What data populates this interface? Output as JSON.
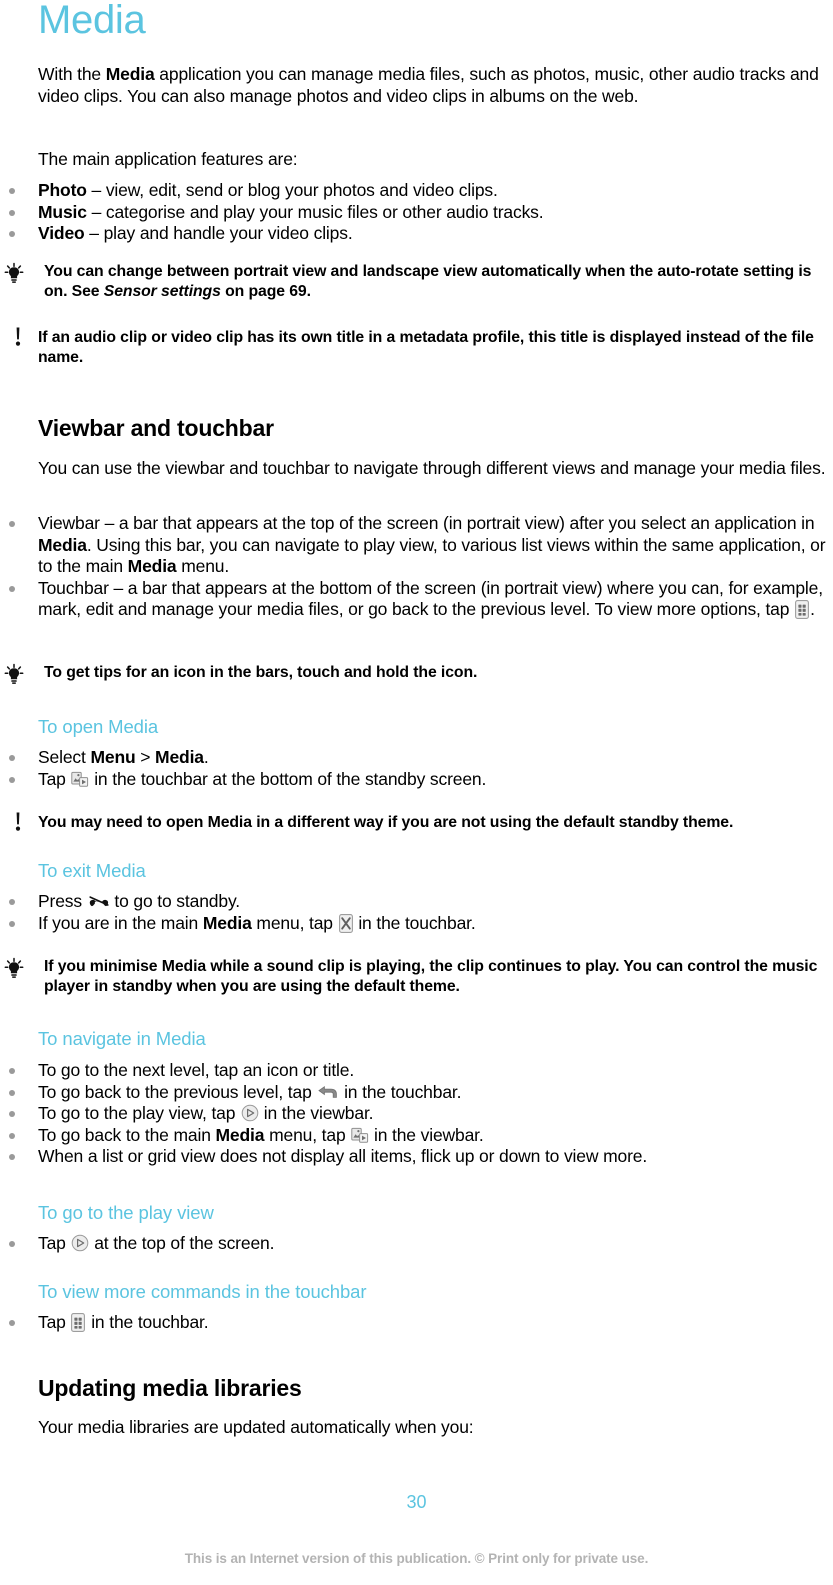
{
  "document": {
    "chapter_title": "Media",
    "page_number": "30",
    "footer": "This is an Internet version of this publication. © Print only for private use.",
    "accent_color": "#5bc4e0",
    "bullet_color": "#9a9a9a"
  },
  "intro": {
    "paragraph_1_pre": "With the ",
    "paragraph_1_bold": "Media",
    "paragraph_1_post": " application you can manage media files, such as photos, music, other audio tracks and video clips. You can also manage photos and video clips in albums on the web.",
    "paragraph_2": "The main application features are:",
    "features": [
      {
        "term": "Photo",
        "desc": " – view, edit, send or blog your photos and video clips."
      },
      {
        "term": "Music",
        "desc": " – categorise and play your music files or other audio tracks."
      },
      {
        "term": "Video",
        "desc": " – play and handle your video clips."
      }
    ],
    "tip_1_a": "You can change between portrait view and landscape view automatically when the auto-rotate setting is on. See ",
    "tip_1_italic": "Sensor settings",
    "tip_1_b": " on page 69.",
    "note_1": "If an audio clip or video clip has its own title in a metadata profile, this title is displayed instead of the file name."
  },
  "viewbar_section": {
    "heading": "Viewbar and touchbar",
    "paragraph": "You can use the viewbar and touchbar to navigate through different views and manage your media files.",
    "bullet_viewbar_a": "Viewbar – a bar that appears at the top of the screen (in portrait view) after you select an application in ",
    "bullet_viewbar_bold_1": "Media",
    "bullet_viewbar_b": ". Using this bar, you can navigate to play view, to various list views within the same application, or to the main ",
    "bullet_viewbar_bold_2": "Media",
    "bullet_viewbar_c": " menu.",
    "bullet_touchbar_a": "Touchbar – a bar that appears at the bottom of the screen (in portrait view) where you can, for example, mark, edit and manage your media files, or go back to the previous level. To view more options, tap ",
    "bullet_touchbar_icon": "more-options-icon",
    "bullet_touchbar_b": ".",
    "tip": "To get tips for an icon in the bars, touch and hold the icon."
  },
  "open_media": {
    "heading": "To open Media",
    "bullet_1_a": "Select ",
    "bullet_1_bold_1": "Menu",
    "bullet_1_b": " > ",
    "bullet_1_bold_2": "Media",
    "bullet_1_c": ".",
    "bullet_2_a": "Tap ",
    "bullet_2_icon": "media-icon",
    "bullet_2_b": " in the touchbar at the bottom of the standby screen.",
    "note_a": "You may need to open ",
    "note_bold": "Media",
    "note_b": " in a different way if you are not using the default standby theme."
  },
  "exit_media": {
    "heading": "To exit Media",
    "bullet_1_a": "Press ",
    "bullet_1_icon": "end-call-icon",
    "bullet_1_b": " to go to standby.",
    "bullet_2_a": "If you are in the main ",
    "bullet_2_bold": "Media",
    "bullet_2_b": " menu, tap ",
    "bullet_2_icon": "close-icon",
    "bullet_2_c": " in the touchbar.",
    "tip_a": "If you minimise ",
    "tip_bold": "Media",
    "tip_b": " while a sound clip is playing, the clip continues to play. You can control the music player in standby when you are using the default theme."
  },
  "navigate_media": {
    "heading": "To navigate in Media",
    "bullet_1": "To go to the next level, tap an icon or title.",
    "bullet_2_a": "To go back to the previous level, tap ",
    "bullet_2_icon": "back-arrow-icon",
    "bullet_2_b": " in the touchbar.",
    "bullet_3_a": "To go to the play view, tap ",
    "bullet_3_icon": "play-view-icon",
    "bullet_3_b": " in the viewbar.",
    "bullet_4_a": "To go back to the main ",
    "bullet_4_bold": "Media",
    "bullet_4_b": " menu, tap ",
    "bullet_4_icon": "media-icon",
    "bullet_4_c": " in the viewbar.",
    "bullet_5": "When a list or grid view does not display all items, flick up or down to view more."
  },
  "play_view": {
    "heading": "To go to the play view",
    "bullet_a": "Tap ",
    "bullet_icon": "play-view-icon",
    "bullet_b": " at the top of the screen."
  },
  "more_commands": {
    "heading": "To view more commands in the touchbar",
    "bullet_a": "Tap ",
    "bullet_icon": "more-options-icon",
    "bullet_b": " in the touchbar."
  },
  "updating": {
    "heading": "Updating media libraries",
    "paragraph": "Your media libraries are updated automatically when you:"
  }
}
